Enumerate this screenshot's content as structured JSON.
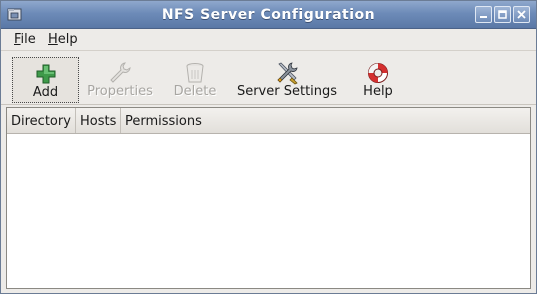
{
  "window": {
    "title": "NFS Server Configuration",
    "icon": "folder-network-icon"
  },
  "menubar": {
    "items": [
      {
        "label": "File"
      },
      {
        "label": "Help"
      }
    ]
  },
  "toolbar": {
    "buttons": [
      {
        "label": "Add",
        "icon": "plus-icon",
        "enabled": true
      },
      {
        "label": "Properties",
        "icon": "wrench-icon",
        "enabled": false
      },
      {
        "label": "Delete",
        "icon": "trash-icon",
        "enabled": false
      },
      {
        "label": "Server Settings",
        "icon": "tools-icon",
        "enabled": true
      },
      {
        "label": "Help",
        "icon": "lifebuoy-icon",
        "enabled": true
      }
    ]
  },
  "table": {
    "columns": [
      "Directory",
      "Hosts",
      "Permissions"
    ],
    "rows": []
  },
  "colors": {
    "titlebar": "#6d8bb8",
    "window_bg": "#edebe8",
    "disabled_text": "#a8a6a2"
  }
}
